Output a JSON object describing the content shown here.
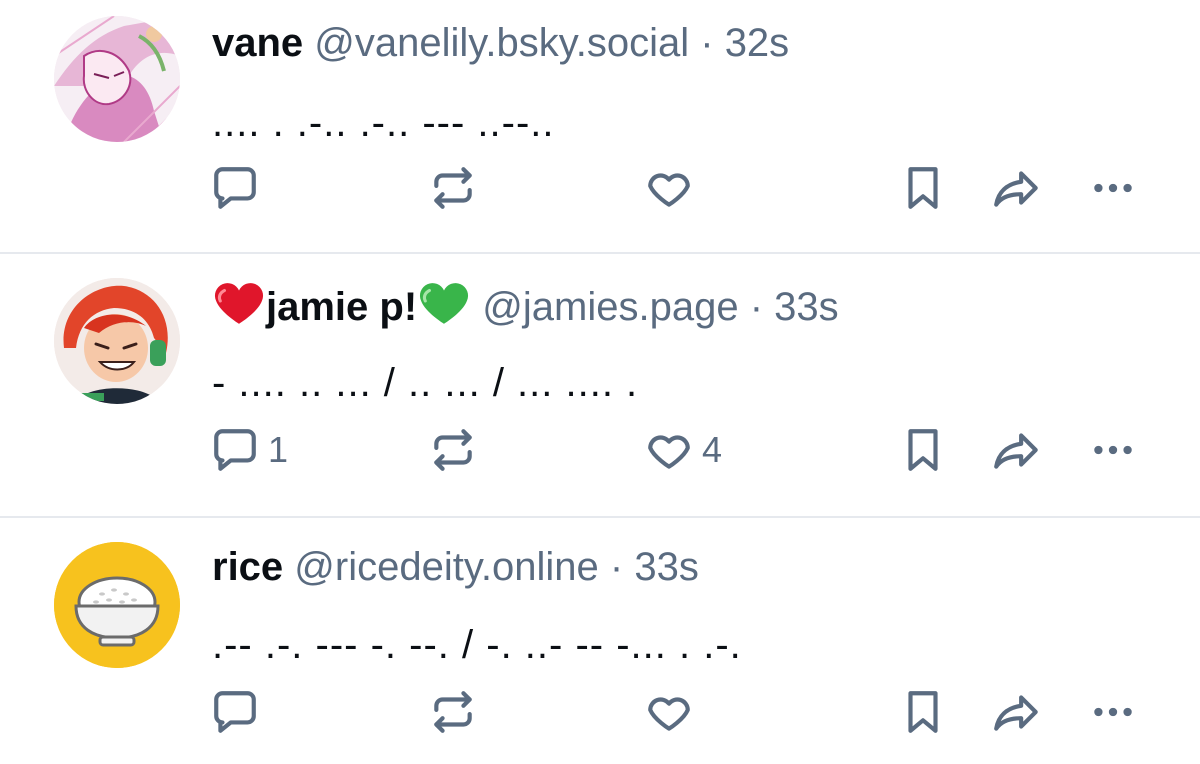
{
  "posts": [
    {
      "author": {
        "display_name": "vane",
        "handle": "@vanelily.bsky.social",
        "avatar": "avatar-vane-illustration"
      },
      "separator": "·",
      "age": "32s",
      "text": ".... . .-.. .-.. --- ..--..",
      "actions": {
        "reply_count": "",
        "repost_count": "",
        "like_count": ""
      }
    },
    {
      "author": {
        "display_name_prefix_emoji": "red-heart-emoji",
        "display_name": "jamie p!",
        "display_name_suffix_emoji": "green-heart-emoji",
        "handle": "@jamies.page",
        "avatar": "avatar-jamie-illustration"
      },
      "separator": "·",
      "age": "33s",
      "text": "- .... .. ... / .. ... / ... .... .",
      "actions": {
        "reply_count": "1",
        "repost_count": "",
        "like_count": "4"
      }
    },
    {
      "author": {
        "display_name": "rice",
        "handle": "@ricedeity.online",
        "avatar": "avatar-rice-bowl"
      },
      "separator": "·",
      "age": "33s",
      "text": ".-- .-. --- -. --. / -. ..- -- -... . .-.",
      "actions": {
        "reply_count": "",
        "repost_count": "",
        "like_count": ""
      }
    }
  ],
  "icons": {
    "reply": "reply-icon",
    "repost": "repost-icon",
    "like": "heart-icon",
    "bookmark": "bookmark-icon",
    "share": "share-icon",
    "more": "more-options-icon"
  },
  "colors": {
    "icon": "#5a6b80",
    "text": "#0b0f14",
    "muted": "#5a6b80",
    "divider": "#e6e9ee",
    "rice_avatar_bg": "#f7c21e"
  }
}
